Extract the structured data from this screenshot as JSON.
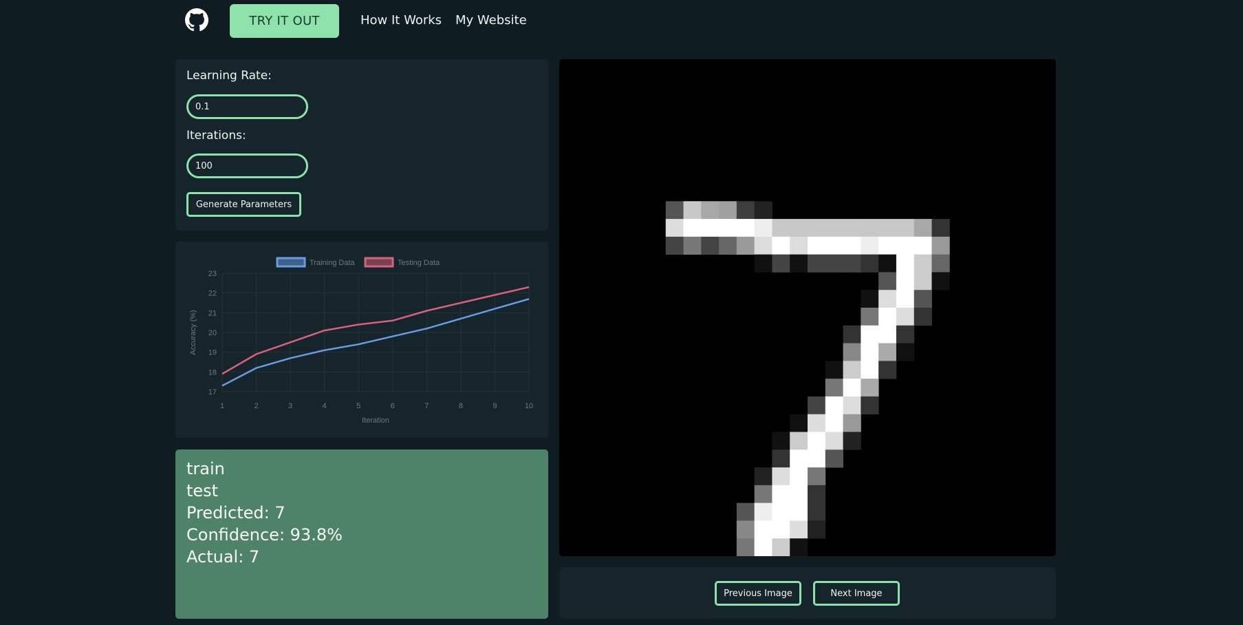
{
  "nav": {
    "try_label": "TRY IT OUT",
    "how_label": "How It Works",
    "website_label": "My Website"
  },
  "params": {
    "lr_label": "Learning Rate:",
    "lr_value": "0.1",
    "it_label": "Iterations:",
    "it_value": "100",
    "generate_label": "Generate Parameters"
  },
  "chart_data": {
    "type": "line",
    "x": [
      1,
      2,
      3,
      4,
      5,
      6,
      7,
      8,
      9,
      10
    ],
    "series": [
      {
        "name": "Training Data",
        "color": "#6a9be3",
        "values": [
          17.3,
          18.2,
          18.7,
          19.1,
          19.4,
          19.8,
          20.2,
          20.7,
          21.2,
          21.7
        ]
      },
      {
        "name": "Testing Data",
        "color": "#d9627a",
        "values": [
          17.9,
          18.9,
          19.5,
          20.1,
          20.4,
          20.6,
          21.1,
          21.5,
          21.9,
          22.3
        ]
      }
    ],
    "xlabel": "Iteration",
    "ylabel": "Accuracy (%)",
    "yticks": [
      17,
      18,
      19,
      20,
      21,
      22,
      23
    ],
    "ylim": [
      17,
      23
    ],
    "grid": true,
    "legend": "top-center"
  },
  "result": {
    "line1": "train",
    "line2": "test",
    "predicted": "Predicted: 7",
    "confidence": "Confidence: 93.8%",
    "actual": "Actual: 7"
  },
  "digit": {
    "description": "MNIST digit 7",
    "grid_size": 28,
    "pixels": [
      [
        6,
        8,
        "#555"
      ],
      [
        7,
        8,
        "#c8c8c8"
      ],
      [
        8,
        8,
        "#a8a8a8"
      ],
      [
        9,
        8,
        "#a0a0a0"
      ],
      [
        10,
        8,
        "#3e3e3e"
      ],
      [
        11,
        8,
        "#222"
      ],
      [
        6,
        9,
        "#ddd"
      ],
      [
        7,
        9,
        "#fff"
      ],
      [
        8,
        9,
        "#fff"
      ],
      [
        9,
        9,
        "#fff"
      ],
      [
        10,
        9,
        "#fff"
      ],
      [
        11,
        9,
        "#eee"
      ],
      [
        12,
        9,
        "#c8c8c8"
      ],
      [
        13,
        9,
        "#c8c8c8"
      ],
      [
        14,
        9,
        "#c8c8c8"
      ],
      [
        15,
        9,
        "#c8c8c8"
      ],
      [
        16,
        9,
        "#c8c8c8"
      ],
      [
        17,
        9,
        "#c8c8c8"
      ],
      [
        18,
        9,
        "#c8c8c8"
      ],
      [
        19,
        9,
        "#c8c8c8"
      ],
      [
        20,
        9,
        "#a8a8a8"
      ],
      [
        21,
        9,
        "#333"
      ],
      [
        6,
        10,
        "#444"
      ],
      [
        7,
        10,
        "#777"
      ],
      [
        8,
        10,
        "#444"
      ],
      [
        9,
        10,
        "#666"
      ],
      [
        10,
        10,
        "#999"
      ],
      [
        11,
        10,
        "#ddd"
      ],
      [
        12,
        10,
        "#fff"
      ],
      [
        13,
        10,
        "#ddd"
      ],
      [
        14,
        10,
        "#fff"
      ],
      [
        15,
        10,
        "#fff"
      ],
      [
        16,
        10,
        "#fff"
      ],
      [
        17,
        10,
        "#eee"
      ],
      [
        18,
        10,
        "#fff"
      ],
      [
        19,
        10,
        "#fff"
      ],
      [
        20,
        10,
        "#fff"
      ],
      [
        21,
        10,
        "#999"
      ],
      [
        11,
        11,
        "#111"
      ],
      [
        12,
        11,
        "#444"
      ],
      [
        13,
        11,
        "#111"
      ],
      [
        14,
        11,
        "#444"
      ],
      [
        15,
        11,
        "#444"
      ],
      [
        16,
        11,
        "#444"
      ],
      [
        17,
        11,
        "#333"
      ],
      [
        18,
        11,
        "#111"
      ],
      [
        19,
        11,
        "#fff"
      ],
      [
        20,
        11,
        "#ccc"
      ],
      [
        21,
        11,
        "#666"
      ],
      [
        18,
        12,
        "#555"
      ],
      [
        19,
        12,
        "#fff"
      ],
      [
        20,
        12,
        "#ccc"
      ],
      [
        21,
        12,
        "#111"
      ],
      [
        17,
        13,
        "#111"
      ],
      [
        18,
        13,
        "#ddd"
      ],
      [
        19,
        13,
        "#fff"
      ],
      [
        20,
        13,
        "#555"
      ],
      [
        17,
        14,
        "#777"
      ],
      [
        18,
        14,
        "#fff"
      ],
      [
        19,
        14,
        "#ddd"
      ],
      [
        20,
        14,
        "#333"
      ],
      [
        16,
        15,
        "#333"
      ],
      [
        17,
        15,
        "#fff"
      ],
      [
        18,
        15,
        "#fff"
      ],
      [
        19,
        15,
        "#333"
      ],
      [
        16,
        16,
        "#888"
      ],
      [
        17,
        16,
        "#fff"
      ],
      [
        18,
        16,
        "#aaa"
      ],
      [
        19,
        16,
        "#111"
      ],
      [
        15,
        17,
        "#111"
      ],
      [
        16,
        17,
        "#ccc"
      ],
      [
        17,
        17,
        "#fff"
      ],
      [
        18,
        17,
        "#333"
      ],
      [
        15,
        18,
        "#777"
      ],
      [
        16,
        18,
        "#fff"
      ],
      [
        17,
        18,
        "#aaa"
      ],
      [
        14,
        19,
        "#444"
      ],
      [
        15,
        19,
        "#fff"
      ],
      [
        16,
        19,
        "#ddd"
      ],
      [
        17,
        19,
        "#333"
      ],
      [
        13,
        20,
        "#111"
      ],
      [
        14,
        20,
        "#ddd"
      ],
      [
        15,
        20,
        "#fff"
      ],
      [
        16,
        20,
        "#999"
      ],
      [
        12,
        21,
        "#111"
      ],
      [
        13,
        21,
        "#ccc"
      ],
      [
        14,
        21,
        "#fff"
      ],
      [
        15,
        21,
        "#ddd"
      ],
      [
        16,
        21,
        "#222"
      ],
      [
        12,
        22,
        "#333"
      ],
      [
        13,
        22,
        "#fff"
      ],
      [
        14,
        22,
        "#fff"
      ],
      [
        15,
        22,
        "#555"
      ],
      [
        11,
        23,
        "#222"
      ],
      [
        12,
        23,
        "#ddd"
      ],
      [
        13,
        23,
        "#fff"
      ],
      [
        14,
        23,
        "#777"
      ],
      [
        11,
        24,
        "#777"
      ],
      [
        12,
        24,
        "#fff"
      ],
      [
        13,
        24,
        "#fff"
      ],
      [
        14,
        24,
        "#333"
      ],
      [
        10,
        25,
        "#555"
      ],
      [
        11,
        25,
        "#eee"
      ],
      [
        12,
        25,
        "#fff"
      ],
      [
        13,
        25,
        "#fff"
      ],
      [
        14,
        25,
        "#333"
      ],
      [
        10,
        26,
        "#888"
      ],
      [
        11,
        26,
        "#fff"
      ],
      [
        12,
        26,
        "#fff"
      ],
      [
        13,
        26,
        "#ddd"
      ],
      [
        14,
        26,
        "#222"
      ],
      [
        10,
        27,
        "#777"
      ],
      [
        11,
        27,
        "#fff"
      ],
      [
        12,
        27,
        "#ccc"
      ],
      [
        13,
        27,
        "#111"
      ]
    ]
  },
  "image_nav": {
    "prev_label": "Previous Image",
    "next_label": "Next Image"
  }
}
